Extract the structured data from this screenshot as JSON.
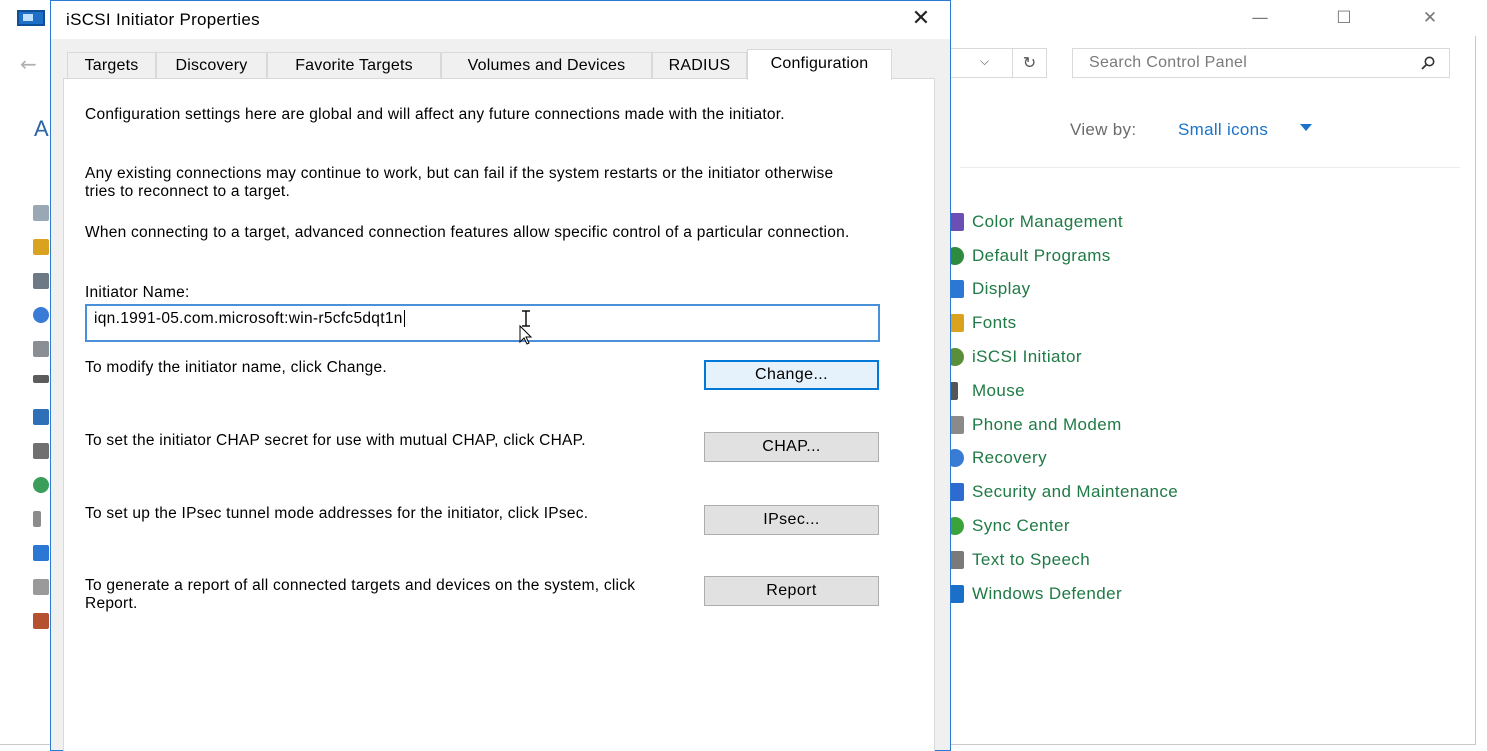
{
  "control_panel": {
    "search_placeholder": "Search Control Panel",
    "heading_letter": "A",
    "view_by_label": "View by:",
    "view_by_value": "Small icons",
    "items": [
      {
        "label": "Color Management",
        "icon": "color-management-icon",
        "color": "#6b4fb5"
      },
      {
        "label": "Default Programs",
        "icon": "default-programs-icon",
        "color": "#2e8b3d"
      },
      {
        "label": "Display",
        "icon": "display-icon",
        "color": "#2a78d4"
      },
      {
        "label": "Fonts",
        "icon": "fonts-icon",
        "color": "#d9a320"
      },
      {
        "label": "iSCSI Initiator",
        "icon": "iscsi-initiator-icon",
        "color": "#5a8f3a"
      },
      {
        "label": "Mouse",
        "icon": "mouse-icon",
        "color": "#555555"
      },
      {
        "label": "Phone and Modem",
        "icon": "phone-modem-icon",
        "color": "#8a8a8a"
      },
      {
        "label": "Recovery",
        "icon": "recovery-icon",
        "color": "#3a7bd5"
      },
      {
        "label": "Security and Maintenance",
        "icon": "security-flag-icon",
        "color": "#2d6bd0"
      },
      {
        "label": "Sync Center",
        "icon": "sync-center-icon",
        "color": "#3aa33a"
      },
      {
        "label": "Text to Speech",
        "icon": "text-to-speech-icon",
        "color": "#7a7a7a"
      },
      {
        "label": "Windows Defender",
        "icon": "windows-defender-icon",
        "color": "#1a6fc8"
      }
    ]
  },
  "dialog": {
    "title": "iSCSI Initiator Properties",
    "tabs": [
      "Targets",
      "Discovery",
      "Favorite Targets",
      "Volumes and Devices",
      "RADIUS",
      "Configuration"
    ],
    "active_tab": "Configuration",
    "para1": "Configuration settings here are global and will affect any future connections made with the initiator.",
    "para2": "Any existing connections may continue to work, but can fail if the system restarts or the initiator otherwise tries to reconnect to a target.",
    "para3": "When connecting to a target, advanced connection features allow specific control of a particular connection.",
    "initiator_label": "Initiator Name:",
    "initiator_value": "iqn.1991-05.com.microsoft:win-r5cfc5dqt1n",
    "change_text": "To modify the initiator name, click Change.",
    "change_button": "Change...",
    "chap_text": "To set the initiator CHAP secret for use with mutual CHAP, click CHAP.",
    "chap_button": "CHAP...",
    "ipsec_text": "To set up the IPsec tunnel mode addresses for the initiator, click IPsec.",
    "ipsec_button": "IPsec...",
    "report_text": "To generate a report of all connected targets and devices on the system, click Report.",
    "report_button": "Report"
  },
  "colors": {
    "accent": "#0078d7",
    "link_green": "#1f7a45",
    "link_blue": "#1a73c9"
  }
}
